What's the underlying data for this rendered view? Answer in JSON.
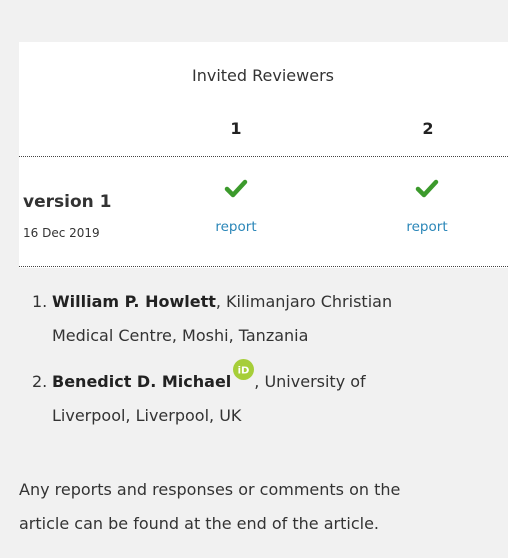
{
  "reviewers_table": {
    "heading": "Invited Reviewers",
    "columns": [
      "1",
      "2"
    ],
    "version_label": "version 1",
    "version_date": "16 Dec 2019",
    "report_label": "report",
    "status_icon": "checkmark-icon",
    "approved_color": "#3c9a2c",
    "link_color": "#2a86b8"
  },
  "reviewers": [
    {
      "num": "1.",
      "name": "William P. Howlett",
      "affiliation_line1": ", Kilimanjaro Christian",
      "affiliation_line2": "Medical Centre, Moshi, Tanzania"
    },
    {
      "num": "2.",
      "name": "Benedict D. Michael",
      "affiliation_line1": ", University of",
      "affiliation_line2": "Liverpool, Liverpool, UK",
      "orcid_icon": "orcid-icon"
    }
  ],
  "footer": {
    "line1": "Any reports and responses or comments on the",
    "line2": "article can be found at the end of the article."
  }
}
